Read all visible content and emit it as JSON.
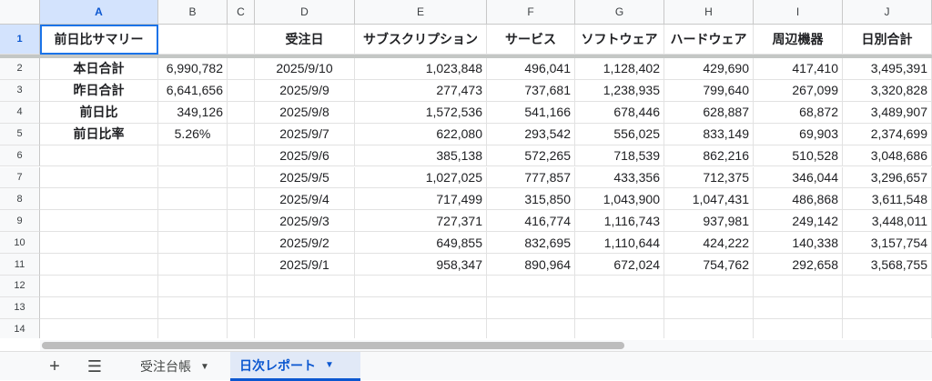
{
  "columns": [
    "A",
    "B",
    "C",
    "D",
    "E",
    "F",
    "G",
    "H",
    "I",
    "J"
  ],
  "header_row": {
    "num": "1",
    "cells": [
      "前日比サマリー",
      "",
      "",
      "受注日",
      "サブスクリプション",
      "サービス",
      "ソフトウェア",
      "ハードウェア",
      "周辺機器",
      "日別合計"
    ]
  },
  "rows": [
    {
      "num": "2",
      "cells": [
        "本日合計",
        "6,990,782",
        "",
        "2025/9/10",
        "1,023,848",
        "496,041",
        "1,128,402",
        "429,690",
        "417,410",
        "3,495,391"
      ]
    },
    {
      "num": "3",
      "cells": [
        "昨日合計",
        "6,641,656",
        "",
        "2025/9/9",
        "277,473",
        "737,681",
        "1,238,935",
        "799,640",
        "267,099",
        "3,320,828"
      ]
    },
    {
      "num": "4",
      "cells": [
        "前日比",
        "349,126",
        "",
        "2025/9/8",
        "1,572,536",
        "541,166",
        "678,446",
        "628,887",
        "68,872",
        "3,489,907"
      ]
    },
    {
      "num": "5",
      "cells": [
        "前日比率",
        "5.26%",
        "",
        "2025/9/7",
        "622,080",
        "293,542",
        "556,025",
        "833,149",
        "69,903",
        "2,374,699"
      ]
    },
    {
      "num": "6",
      "cells": [
        "",
        "",
        "",
        "2025/9/6",
        "385,138",
        "572,265",
        "718,539",
        "862,216",
        "510,528",
        "3,048,686"
      ]
    },
    {
      "num": "7",
      "cells": [
        "",
        "",
        "",
        "2025/9/5",
        "1,027,025",
        "777,857",
        "433,356",
        "712,375",
        "346,044",
        "3,296,657"
      ]
    },
    {
      "num": "8",
      "cells": [
        "",
        "",
        "",
        "2025/9/4",
        "717,499",
        "315,850",
        "1,043,900",
        "1,047,431",
        "486,868",
        "3,611,548"
      ]
    },
    {
      "num": "9",
      "cells": [
        "",
        "",
        "",
        "2025/9/3",
        "727,371",
        "416,774",
        "1,116,743",
        "937,981",
        "249,142",
        "3,448,011"
      ]
    },
    {
      "num": "10",
      "cells": [
        "",
        "",
        "",
        "2025/9/2",
        "649,855",
        "832,695",
        "1,110,644",
        "424,222",
        "140,338",
        "3,157,754"
      ]
    },
    {
      "num": "11",
      "cells": [
        "",
        "",
        "",
        "2025/9/1",
        "958,347",
        "890,964",
        "672,024",
        "754,762",
        "292,658",
        "3,568,755"
      ]
    },
    {
      "num": "12",
      "cells": [
        "",
        "",
        "",
        "",
        "",
        "",
        "",
        "",
        "",
        ""
      ]
    },
    {
      "num": "13",
      "cells": [
        "",
        "",
        "",
        "",
        "",
        "",
        "",
        "",
        "",
        ""
      ]
    },
    {
      "num": "14",
      "cells": [
        "",
        "",
        "",
        "",
        "",
        "",
        "",
        "",
        "",
        ""
      ]
    }
  ],
  "tabbar": {
    "add_icon": "+",
    "menu_icon": "☰",
    "tabs": [
      {
        "label": "受注台帳",
        "caret": "▼"
      },
      {
        "label": "日次レポート",
        "caret": "▼"
      }
    ]
  },
  "colors": {
    "accent": "#0b57d0",
    "selected_header": "#d3e3fd"
  }
}
